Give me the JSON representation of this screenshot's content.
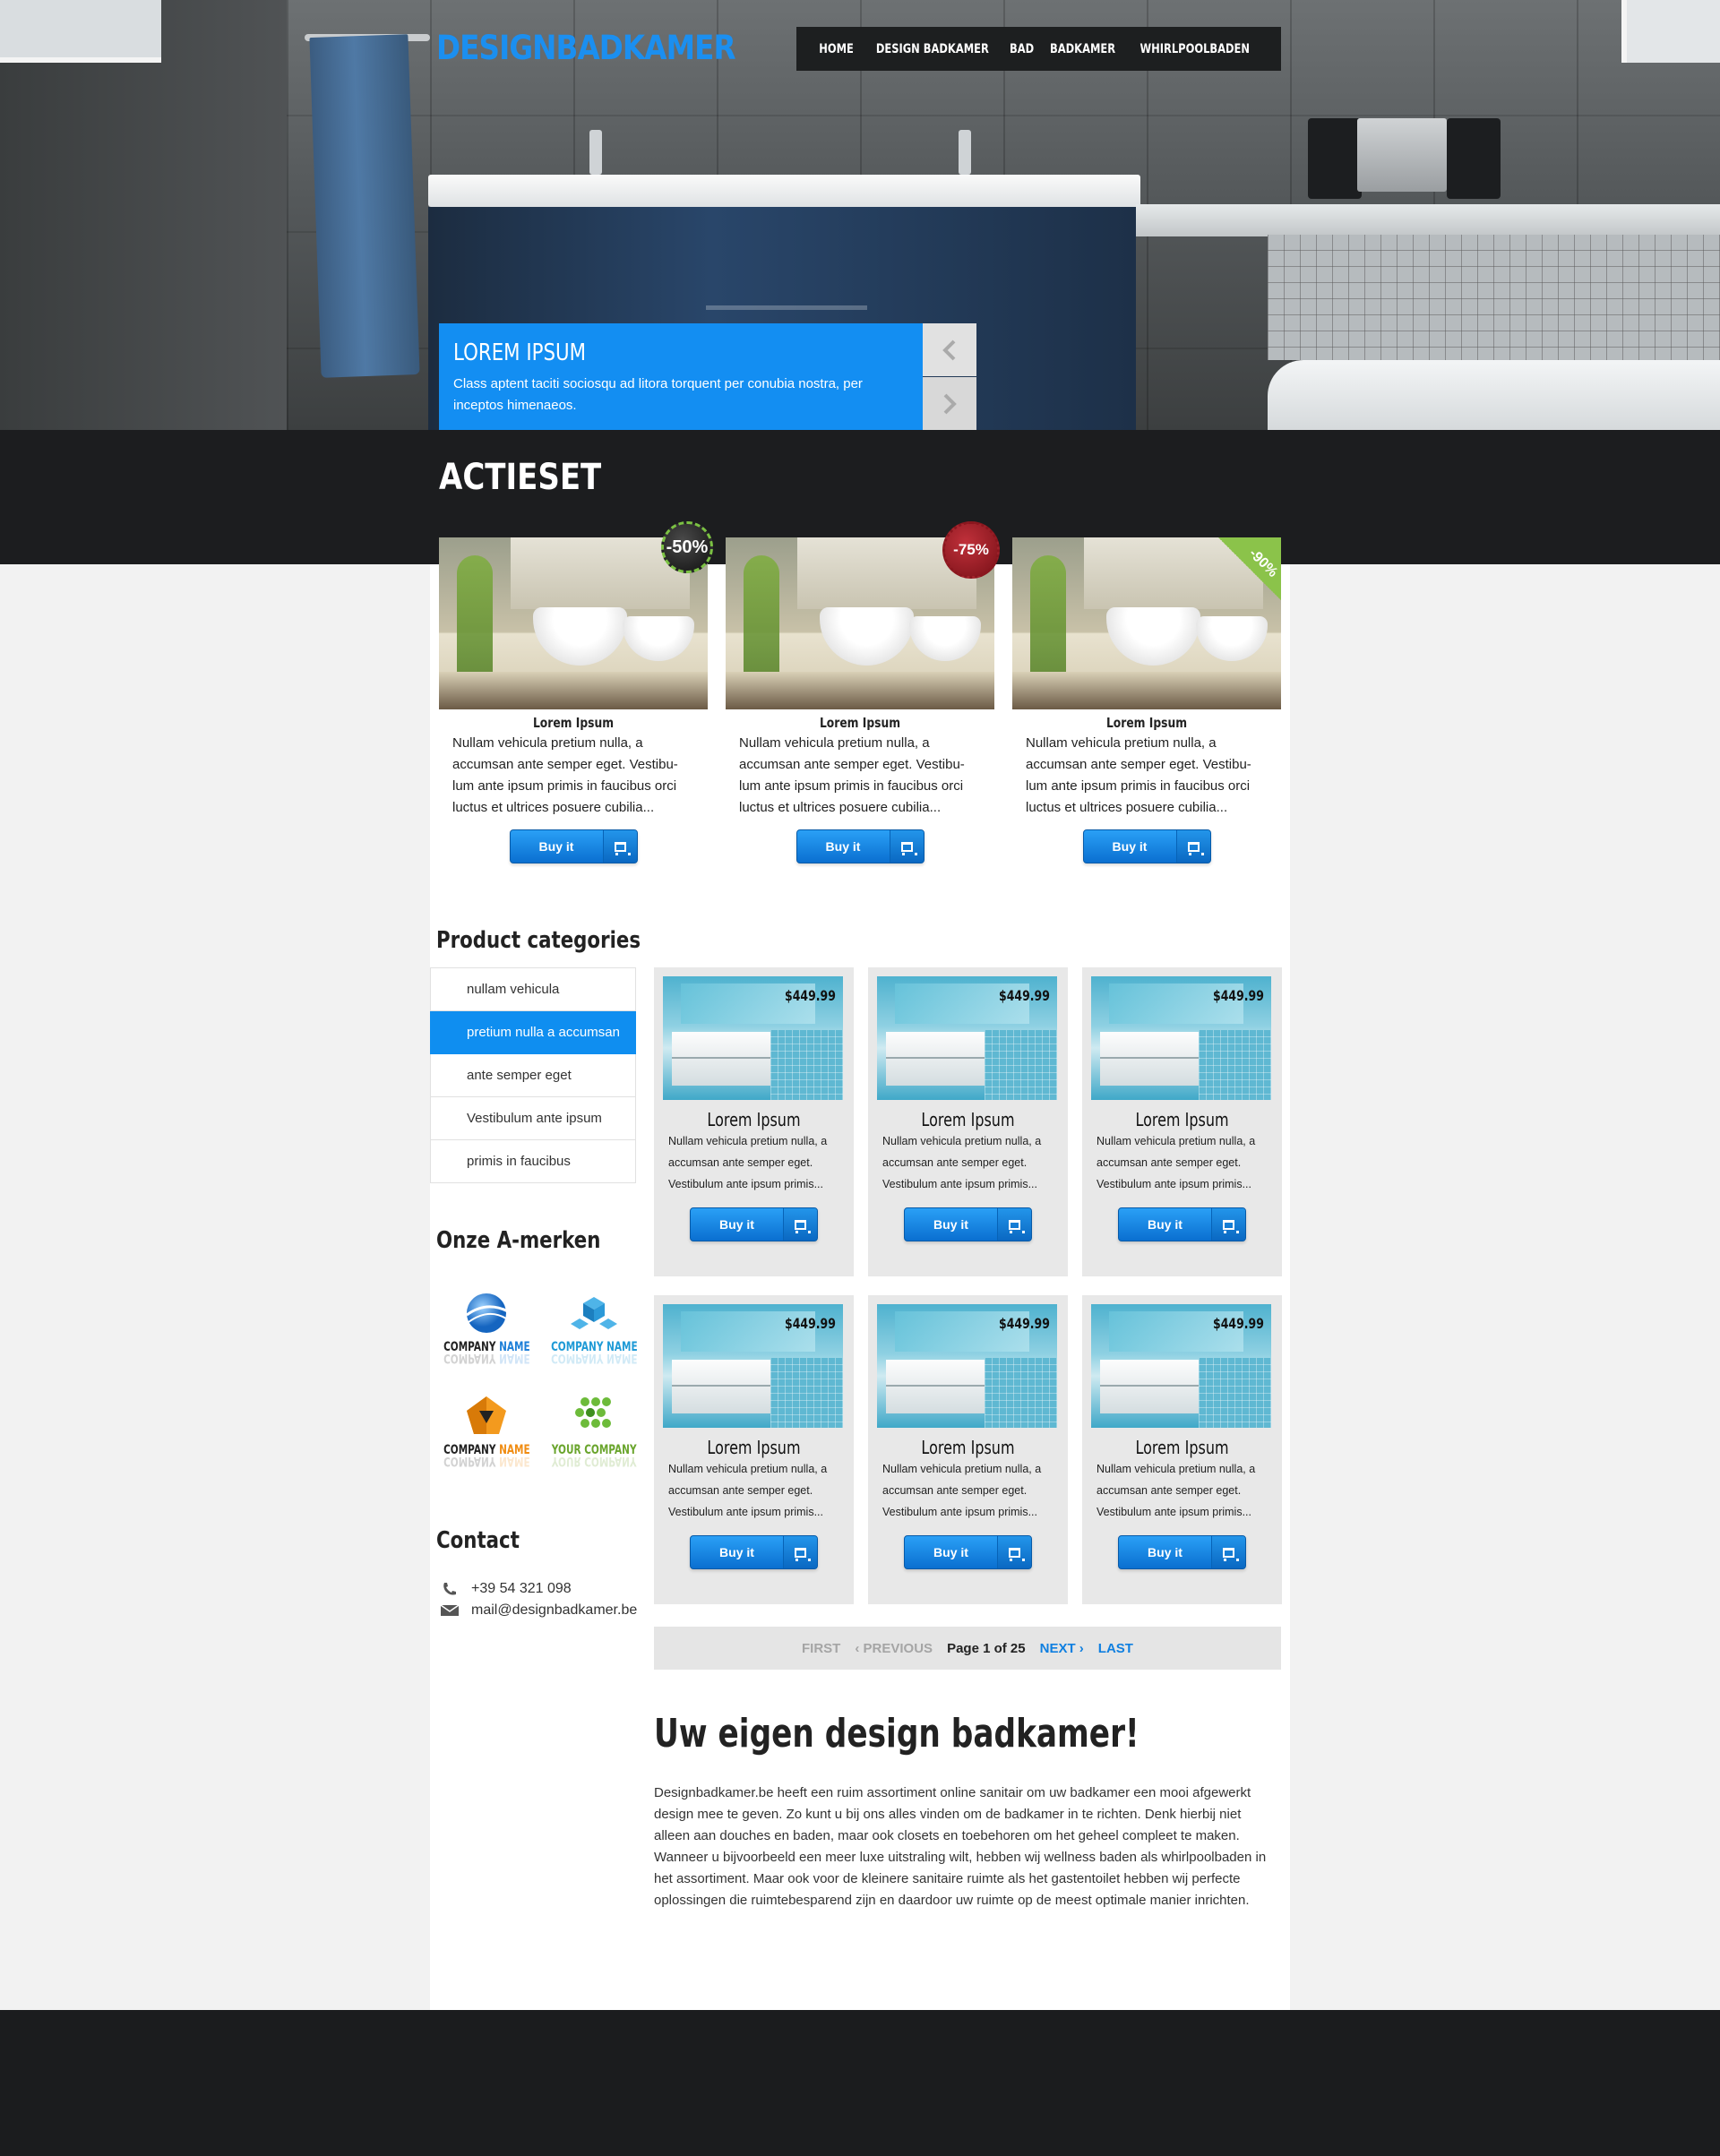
{
  "header": {
    "logo": "DESIGNBADKAMER",
    "nav": [
      "HOME",
      "DESIGN BADKAMER",
      "BAD",
      "BADKAMER",
      "WHIRLPOOLBADEN"
    ]
  },
  "slider": {
    "title": "LOREM IPSUM",
    "text": "Class aptent taciti sociosqu ad litora torquent per conubia nostra, per inceptos himenaeos."
  },
  "actieset": {
    "title": "ACTIESET",
    "items": [
      {
        "badge": "-50%",
        "name": "Lorem Ipsum",
        "desc": "Nullam vehicula pretium nulla, a accumsan ante semper eget. Vestibu-lum ante ipsum primis in faucibus orci luctus et ultrices posuere cubilia...",
        "button": "Buy it"
      },
      {
        "badge": "-75%",
        "name": "Lorem Ipsum",
        "desc": "Nullam vehicula pretium nulla, a accumsan ante semper eget. Vestibu-lum ante ipsum primis in faucibus orci luctus et ultrices posuere cubilia...",
        "button": "Buy it"
      },
      {
        "badge": "-90%",
        "name": "Lorem Ipsum",
        "desc": "Nullam vehicula pretium nulla, a accumsan ante semper eget. Vestibu-lum ante ipsum primis in faucibus orci luctus et ultrices posuere cubilia...",
        "button": "Buy it"
      }
    ]
  },
  "sidebar": {
    "categories_title": "Product categories",
    "categories": [
      "nullam vehicula",
      "pretium nulla a accumsan",
      "ante semper eget",
      "Vestibulum ante ipsum",
      "primis in faucibus"
    ],
    "active_category": "pretium nulla a accumsan",
    "brands_title": "Onze A-merken",
    "brands": [
      {
        "a": "COMPANY",
        "b": "NAME"
      },
      {
        "a": "COMPANY",
        "b": "NAME"
      },
      {
        "a": "COMPANY",
        "b": "NAME"
      },
      {
        "a": "YOUR",
        "b": "COMPANY"
      }
    ],
    "contact_title": "Contact",
    "phone": "+39 54 321 098",
    "email": "mail@designbadkamer.be"
  },
  "products": [
    {
      "price": "$449.99",
      "name": "Lorem Ipsum",
      "desc": "Nullam vehicula pretium nulla, a accumsan ante semper eget. Vestibulum ante ipsum primis...",
      "button": "Buy it"
    },
    {
      "price": "$449.99",
      "name": "Lorem Ipsum",
      "desc": "Nullam vehicula pretium nulla, a accumsan ante semper eget. Vestibulum ante ipsum primis...",
      "button": "Buy it"
    },
    {
      "price": "$449.99",
      "name": "Lorem Ipsum",
      "desc": "Nullam vehicula pretium nulla, a accumsan ante semper eget. Vestibulum ante ipsum primis...",
      "button": "Buy it"
    },
    {
      "price": "$449.99",
      "name": "Lorem Ipsum",
      "desc": "Nullam vehicula pretium nulla, a accumsan ante semper eget. Vestibulum ante ipsum primis...",
      "button": "Buy it"
    },
    {
      "price": "$449.99",
      "name": "Lorem Ipsum",
      "desc": "Nullam vehicula pretium nulla, a accumsan ante semper eget. Vestibulum ante ipsum primis...",
      "button": "Buy it"
    },
    {
      "price": "$449.99",
      "name": "Lorem Ipsum",
      "desc": "Nullam vehicula pretium nulla, a accumsan ante semper eget. Vestibulum ante ipsum primis...",
      "button": "Buy it"
    }
  ],
  "pager": {
    "first": "FIRST",
    "previous": "PREVIOUS",
    "page_label": "Page 1 of 25",
    "next": "NEXT",
    "last": "LAST"
  },
  "about": {
    "title": "Uw eigen design badkamer!",
    "text": "Designbadkamer.be heeft een ruim assortiment online sanitair om uw badkamer een mooi afgewerkt design mee te geven. Zo kunt u bij ons alles vinden om de badkamer in te richten. Denk hierbij niet alleen aan douches en baden, maar ook closets en toebehoren om het geheel compleet te maken. Wanneer u bijvoorbeeld een meer luxe uitstraling wilt, hebben wij wellness baden als whirlpoolbaden in het assortiment. Maar ook voor de kleinere sanitaire ruimte als het gastentoilet hebben wij perfecte oplossingen die ruimtebesparend zijn en daardoor uw ruimte op de meest optimale manier inrichten."
  },
  "colors": {
    "accent": "#138ef2",
    "dark": "#1c1d1f",
    "card": "#e8e8e8"
  }
}
